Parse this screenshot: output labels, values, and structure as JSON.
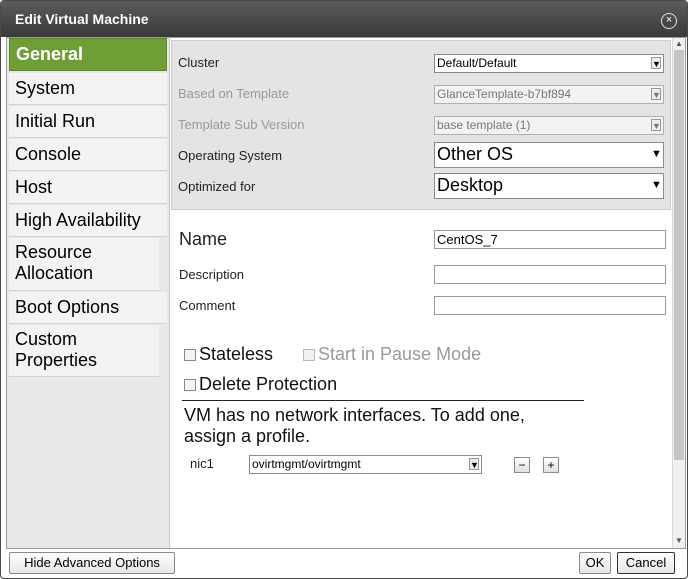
{
  "dialog": {
    "title": "Edit Virtual Machine",
    "close_icon": "×"
  },
  "sidebar": {
    "items": [
      {
        "label": "General",
        "active": true
      },
      {
        "label": "System"
      },
      {
        "label": "Initial Run"
      },
      {
        "label": "Console"
      },
      {
        "label": "Host"
      },
      {
        "label": "High Availability"
      },
      {
        "label": "Resource Allocation"
      },
      {
        "label": "Boot Options"
      },
      {
        "label": "Custom Properties"
      }
    ]
  },
  "general": {
    "cluster_label": "Cluster",
    "cluster_value": "Default/Default",
    "template_label": "Based on Template",
    "template_value": "GlanceTemplate-b7bf894",
    "subversion_label": "Template Sub Version",
    "subversion_value": "base template (1)",
    "os_label": "Operating System",
    "os_value": "Other OS",
    "optimized_label": "Optimized for",
    "optimized_value": "Desktop",
    "name_label": "Name",
    "name_value": "CentOS_7",
    "description_label": "Description",
    "description_value": "",
    "comment_label": "Comment",
    "comment_value": "",
    "stateless_label": "Stateless",
    "pause_label": "Start in Pause Mode",
    "delete_protection_label": "Delete Protection",
    "network_message": "VM has no network interfaces. To add one, assign a profile.",
    "nic_label": "nic1",
    "nic_profile": "ovirtmgmt/ovirtmgmt",
    "remove_nic": "−",
    "add_nic": "+"
  },
  "footer": {
    "advanced_label": "Hide Advanced Options",
    "ok_label": "OK",
    "cancel_label": "Cancel"
  },
  "icons": {
    "arrow": "▼",
    "scroll_up": "▲",
    "scroll_down": "▼"
  }
}
